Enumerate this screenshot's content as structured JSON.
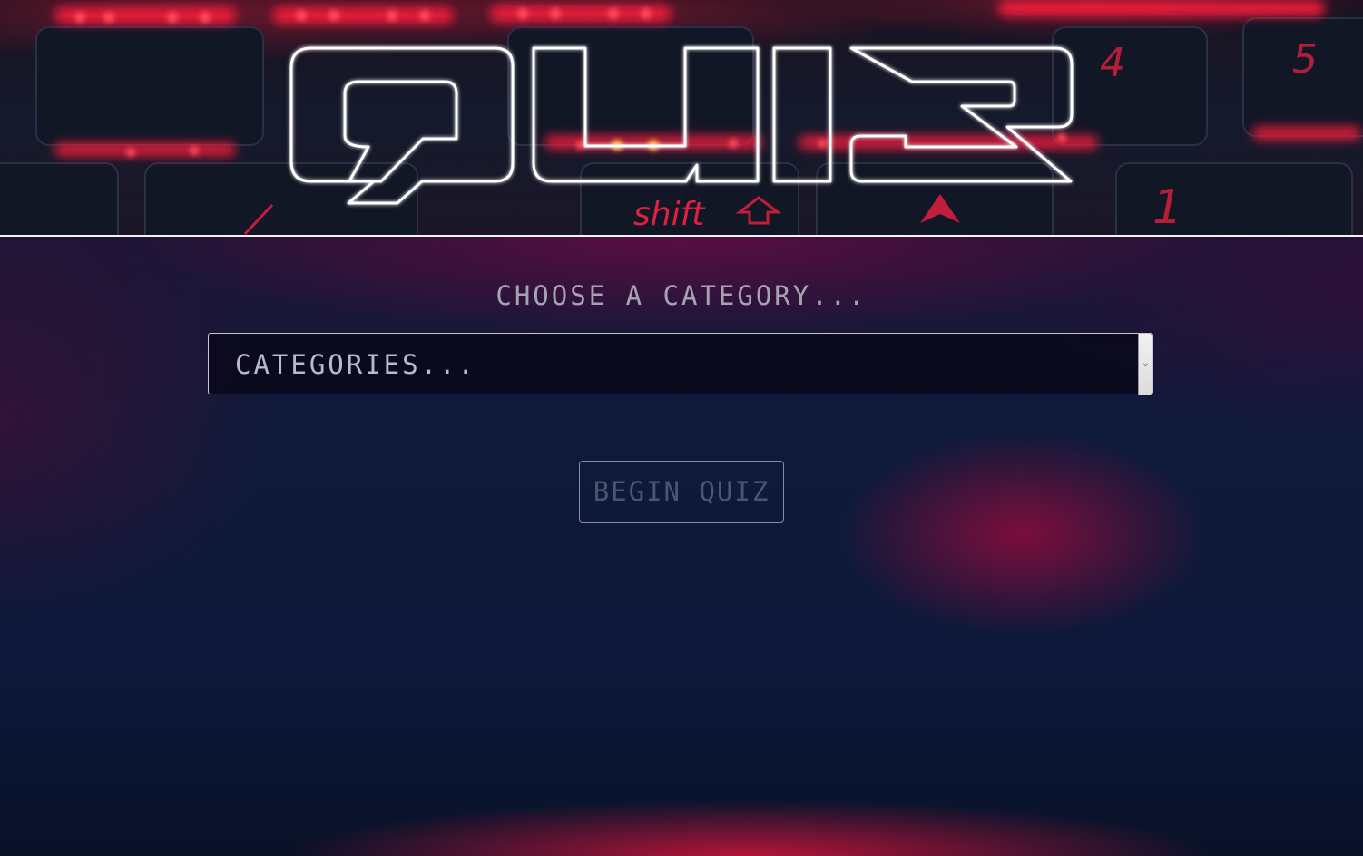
{
  "header": {
    "logo_text": "QUIZ",
    "keycap_labels": [
      "shift",
      "4",
      "5",
      "1"
    ]
  },
  "main": {
    "prompt": "CHOOSE A CATEGORY...",
    "category_select": {
      "selected": "CATEGORIES..."
    },
    "begin_button_label": "BEGIN QUIZ"
  },
  "colors": {
    "accent_red": "#ff1e3c",
    "logo_outline": "#ffffff",
    "text_muted": "#a7a2b3"
  }
}
